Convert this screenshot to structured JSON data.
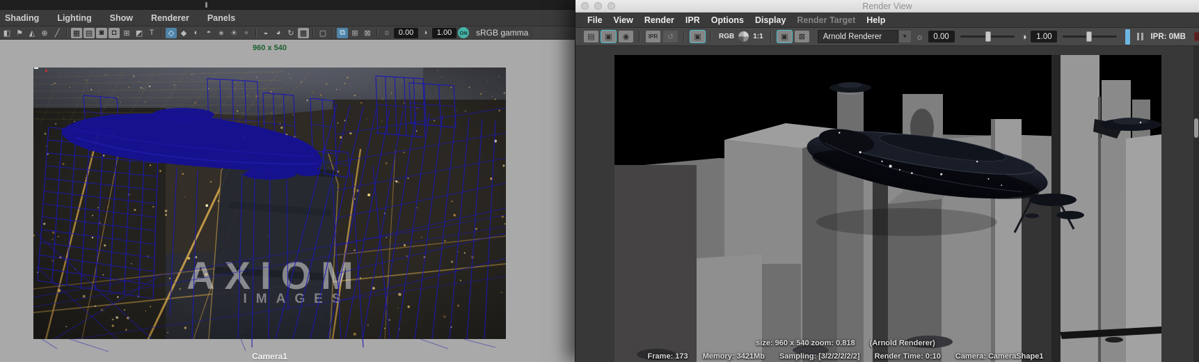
{
  "maya": {
    "menus": [
      "Shading",
      "Lighting",
      "Show",
      "Renderer",
      "Panels"
    ],
    "toolbar": {
      "icons": [
        {
          "name": "camera-tools-icon",
          "g": "◧"
        },
        {
          "name": "bookmark-icon",
          "g": "⚑"
        },
        {
          "name": "paint-tool-icon",
          "g": "◭"
        },
        {
          "name": "pivot-tool-icon",
          "g": "⊕"
        },
        {
          "name": "pencil-tool-icon",
          "g": "╱"
        },
        {
          "name": "divider"
        },
        {
          "name": "grid-icon",
          "g": "▦",
          "lit": true
        },
        {
          "name": "film-gate-icon",
          "g": "▤",
          "lit": true
        },
        {
          "name": "resolution-gate-icon",
          "g": "◙",
          "lit": true
        },
        {
          "name": "gate-mask-icon",
          "g": "◘",
          "lit": true
        },
        {
          "name": "field-chart-icon",
          "g": "⊞"
        },
        {
          "name": "safe-action-icon",
          "g": "◩"
        },
        {
          "name": "safe-title-icon",
          "g": "T"
        },
        {
          "name": "divider"
        },
        {
          "name": "wireframe-mode-icon",
          "g": "◇",
          "active": true
        },
        {
          "name": "smooth-shade-icon",
          "g": "◆"
        },
        {
          "name": "textured-mode-icon",
          "g": "◐"
        },
        {
          "name": "lighting-mode-icon",
          "g": "◓"
        },
        {
          "name": "xray-mode-icon",
          "g": "∗"
        },
        {
          "name": "use-lights-icon",
          "g": "☀"
        },
        {
          "name": "shadows-icon",
          "g": "●",
          "dim": true
        },
        {
          "name": "divider"
        },
        {
          "name": "image-plane-icon",
          "g": "◒"
        },
        {
          "name": "gradient-icon",
          "g": "◕"
        },
        {
          "name": "cycle-icon",
          "g": "↻"
        },
        {
          "name": "checker-icon",
          "g": "▩",
          "lit": true
        },
        {
          "name": "divider"
        },
        {
          "name": "marquee-select-icon",
          "g": "▢"
        },
        {
          "name": "divider"
        },
        {
          "name": "isolate-select-icon",
          "g": "⧉",
          "active": true
        },
        {
          "name": "isolate-add-icon",
          "g": "⊞"
        },
        {
          "name": "isolate-remove-icon",
          "g": "⊠"
        },
        {
          "name": "divider"
        },
        {
          "name": "exposure-icon",
          "g": "☼"
        }
      ],
      "exposure_value": "0.00",
      "contrast_glyph": "◑",
      "gamma_value": "1.00",
      "on_button": "ON",
      "colorspace": "sRGB gamma"
    },
    "viewport": {
      "resolution_label": "960 x 540",
      "camera_label": "Camera1",
      "watermark_line1": "AXIOM",
      "watermark_line2": "IMAGES"
    }
  },
  "render_view": {
    "title": "Render View",
    "menus": [
      {
        "label": "File"
      },
      {
        "label": "View"
      },
      {
        "label": "Render"
      },
      {
        "label": "IPR"
      },
      {
        "label": "Options"
      },
      {
        "label": "Display"
      },
      {
        "label": "Render Target",
        "disabled": true
      },
      {
        "label": "Help"
      }
    ],
    "toolbar": {
      "icons": [
        {
          "name": "render-icon",
          "g": "▤"
        },
        {
          "name": "render-region-icon",
          "g": "▣",
          "teal": true
        },
        {
          "name": "snapshot-icon",
          "g": "◉"
        },
        {
          "name": "divider"
        },
        {
          "name": "ipr-render-icon",
          "g": "IPR"
        },
        {
          "name": "ipr-refresh-icon",
          "g": "↺",
          "dim": true
        },
        {
          "name": "divider"
        },
        {
          "name": "ipr-update-region-icon",
          "g": "▣",
          "teal": true
        },
        {
          "name": "divider"
        },
        {
          "name": "rgb-channels-icon",
          "g": "RGB",
          "txt": true
        },
        {
          "name": "alpha-channel-icon",
          "pie": true
        },
        {
          "name": "ratio-1to1-icon",
          "g": "1:1",
          "txt": true
        },
        {
          "name": "divider"
        },
        {
          "name": "keep-image-icon",
          "g": "▣",
          "teal": true
        },
        {
          "name": "remove-image-icon",
          "g": "⊠"
        }
      ],
      "renderer_selected": "Arnold Renderer",
      "chevron_glyph": "▾",
      "aperture_glyph": "☼",
      "exposure_value": "0.00",
      "contrast_glyph": "◑",
      "gamma_value": "1.00",
      "ipr_memory": "IPR: 0MB"
    },
    "status": {
      "size": "size: 960 x 540 zoom: 0.818",
      "renderer": "(Arnold Renderer)",
      "frame": "Frame: 173",
      "memory": "Memory: 3421Mb",
      "sampling": "Sampling: [3/2/2/2/2/2]",
      "render_time": "Render Time: 0:10",
      "camera": "Camera: CameraShape1"
    }
  },
  "colors": {
    "wire_blue": "#1b17b2",
    "ship_navy": "#161292",
    "accent_teal": "#4fc3cf",
    "active_blue": "#4f83a8",
    "ipr_toggle_blue": "#6db5e2",
    "swatch_red": "#571f1f"
  }
}
